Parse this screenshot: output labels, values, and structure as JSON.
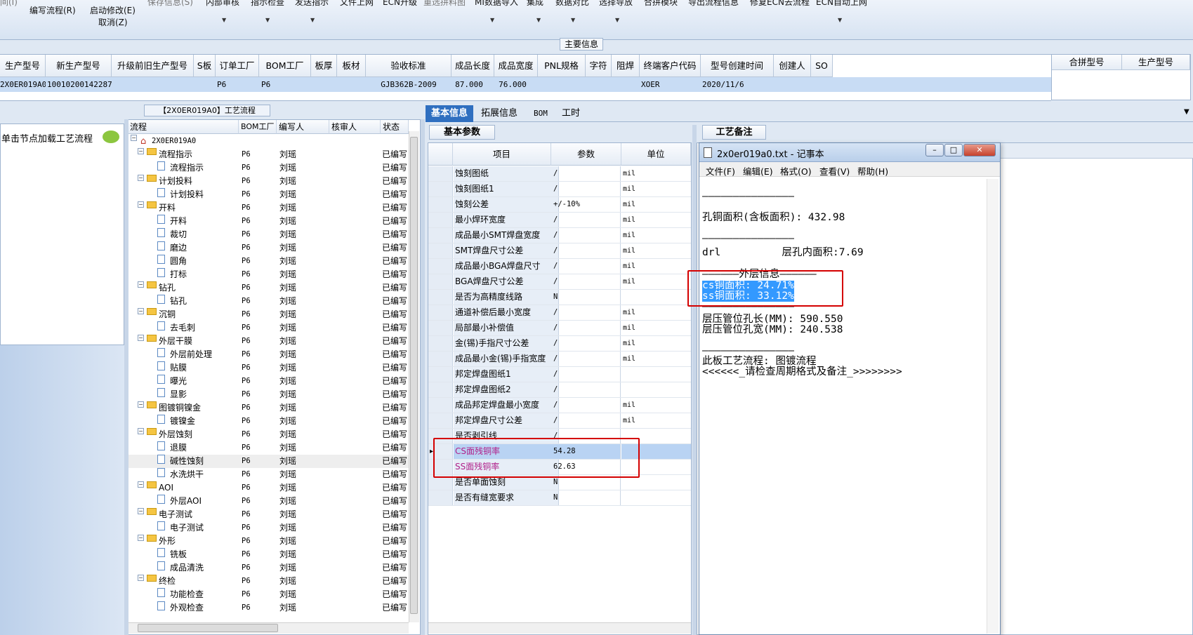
{
  "toolbar": {
    "row1": [
      "间(I)",
      "保存信息(S)",
      "内部审核",
      "指示检查",
      "发送指示",
      "文件上网",
      "ECN升级",
      "重选拼料图",
      "MI数据导入",
      "集成",
      "数据对比",
      "选择导放",
      "合拼模块",
      "导出流程信息",
      "修复ECN去流程",
      "ECN自动上网"
    ],
    "edit_flow": "编写流程(R)",
    "start_modify": "启动修改(E)",
    "cancel": "取消(Z)"
  },
  "main_info": {
    "title": "主要信息",
    "columns": [
      "生产型号",
      "新生产型号",
      "升级前旧生产型号",
      "S板",
      "订单工厂",
      "BOM工厂",
      "板厚",
      "板材",
      "验收标准",
      "成品长度",
      "成品宽度",
      "PNL规格",
      "字符",
      "阻焊",
      "终端客户代码",
      "型号创建时间",
      "创建人",
      "SO"
    ],
    "row": {
      "production_model": "2X0ER019A0",
      "new_model": "10010200142287",
      "order_factory": "P6",
      "bom_factory": "P6",
      "standard": "GJB362B-2009",
      "length": "87.000",
      "width": "76.000",
      "customer_code": "XOER",
      "created": "2020/11/6"
    },
    "merge_columns": [
      "合拼型号",
      "生产型号"
    ]
  },
  "left_panel": {
    "hint": "单击节点加载工艺流程"
  },
  "tree": {
    "title": "【2X0ER019A0】工艺流程",
    "columns": [
      "流程",
      "BOM工厂",
      "编写人",
      "核审人",
      "状态"
    ],
    "root": "2X0ER019A0",
    "rows": [
      {
        "name": "流程指示",
        "level": 1,
        "factory": "P6",
        "author": "刘瑶",
        "status": "已编写"
      },
      {
        "name": "流程指示",
        "level": 2,
        "factory": "P6",
        "author": "刘瑶",
        "status": "已编写"
      },
      {
        "name": "计划投料",
        "level": 1,
        "factory": "P6",
        "author": "刘瑶",
        "status": "已编写"
      },
      {
        "name": "计划投料",
        "level": 2,
        "factory": "P6",
        "author": "刘瑶",
        "status": "已编写"
      },
      {
        "name": "开料",
        "level": 1,
        "factory": "P6",
        "author": "刘瑶",
        "status": "已编写"
      },
      {
        "name": "开料",
        "level": 2,
        "factory": "P6",
        "author": "刘瑶",
        "status": "已编写"
      },
      {
        "name": "裁切",
        "level": 2,
        "factory": "P6",
        "author": "刘瑶",
        "status": "已编写"
      },
      {
        "name": "磨边",
        "level": 2,
        "factory": "P6",
        "author": "刘瑶",
        "status": "已编写"
      },
      {
        "name": "圆角",
        "level": 2,
        "factory": "P6",
        "author": "刘瑶",
        "status": "已编写"
      },
      {
        "name": "打标",
        "level": 2,
        "factory": "P6",
        "author": "刘瑶",
        "status": "已编写"
      },
      {
        "name": "钻孔",
        "level": 1,
        "factory": "P6",
        "author": "刘瑶",
        "status": "已编写"
      },
      {
        "name": "钻孔",
        "level": 2,
        "factory": "P6",
        "author": "刘瑶",
        "status": "已编写"
      },
      {
        "name": "沉铜",
        "level": 1,
        "factory": "P6",
        "author": "刘瑶",
        "status": "已编写"
      },
      {
        "name": "去毛刺",
        "level": 2,
        "factory": "P6",
        "author": "刘瑶",
        "status": "已编写"
      },
      {
        "name": "外层干膜",
        "level": 1,
        "factory": "P6",
        "author": "刘瑶",
        "status": "已编写"
      },
      {
        "name": "外层前处理",
        "level": 2,
        "factory": "P6",
        "author": "刘瑶",
        "status": "已编写"
      },
      {
        "name": "贴膜",
        "level": 2,
        "factory": "P6",
        "author": "刘瑶",
        "status": "已编写"
      },
      {
        "name": "曝光",
        "level": 2,
        "factory": "P6",
        "author": "刘瑶",
        "status": "已编写"
      },
      {
        "name": "显影",
        "level": 2,
        "factory": "P6",
        "author": "刘瑶",
        "status": "已编写"
      },
      {
        "name": "图镀铜镍金",
        "level": 1,
        "factory": "P6",
        "author": "刘瑶",
        "status": "已编写"
      },
      {
        "name": "镀镍金",
        "level": 2,
        "factory": "P6",
        "author": "刘瑶",
        "status": "已编写"
      },
      {
        "name": "外层蚀刻",
        "level": 1,
        "factory": "P6",
        "author": "刘瑶",
        "status": "已编写"
      },
      {
        "name": "退膜",
        "level": 2,
        "factory": "P6",
        "author": "刘瑶",
        "status": "已编写"
      },
      {
        "name": "碱性蚀刻",
        "level": 2,
        "factory": "P6",
        "author": "刘瑶",
        "status": "已编写",
        "selected": true
      },
      {
        "name": "水洗烘干",
        "level": 2,
        "factory": "P6",
        "author": "刘瑶",
        "status": "已编写"
      },
      {
        "name": "AOI",
        "level": 1,
        "factory": "P6",
        "author": "刘瑶",
        "status": "已编写"
      },
      {
        "name": "外层AOI",
        "level": 2,
        "factory": "P6",
        "author": "刘瑶",
        "status": "已编写"
      },
      {
        "name": "电子测试",
        "level": 1,
        "factory": "P6",
        "author": "刘瑶",
        "status": "已编写"
      },
      {
        "name": "电子测试",
        "level": 2,
        "factory": "P6",
        "author": "刘瑶",
        "status": "已编写"
      },
      {
        "name": "外形",
        "level": 1,
        "factory": "P6",
        "author": "刘瑶",
        "status": "已编写"
      },
      {
        "name": "铣板",
        "level": 2,
        "factory": "P6",
        "author": "刘瑶",
        "status": "已编写"
      },
      {
        "name": "成品清洗",
        "level": 2,
        "factory": "P6",
        "author": "刘瑶",
        "status": "已编写"
      },
      {
        "name": "终检",
        "level": 1,
        "factory": "P6",
        "author": "刘瑶",
        "status": "已编写"
      },
      {
        "name": "功能检查",
        "level": 2,
        "factory": "P6",
        "author": "刘瑶",
        "status": "已编写"
      },
      {
        "name": "外观检查",
        "level": 2,
        "factory": "P6",
        "author": "刘瑶",
        "status": "已编写"
      }
    ]
  },
  "tabs": [
    "基本信息",
    "拓展信息",
    "BOM",
    "工时"
  ],
  "params": {
    "tab": "基本参数",
    "columns": [
      "项目",
      "参数",
      "单位"
    ],
    "rows": [
      {
        "item": "蚀刻图纸",
        "value": "/",
        "unit": "mil"
      },
      {
        "item": "蚀刻图纸1",
        "value": "/",
        "unit": "mil"
      },
      {
        "item": "蚀刻公差",
        "value": "+/-10%",
        "unit": "mil"
      },
      {
        "item": "最小焊环宽度",
        "value": "/",
        "unit": "mil"
      },
      {
        "item": "成品最小SMT焊盘宽度",
        "value": "/",
        "unit": "mil"
      },
      {
        "item": "SMT焊盘尺寸公差",
        "value": "/",
        "unit": "mil"
      },
      {
        "item": "成品最小BGA焊盘尺寸",
        "value": "/",
        "unit": "mil"
      },
      {
        "item": "BGA焊盘尺寸公差",
        "value": "/",
        "unit": "mil"
      },
      {
        "item": "是否为高精度线路",
        "value": "N",
        "unit": ""
      },
      {
        "item": "通道补偿后最小宽度",
        "value": "/",
        "unit": "mil"
      },
      {
        "item": "局部最小补偿值",
        "value": "/",
        "unit": "mil"
      },
      {
        "item": "金(锡)手指尺寸公差",
        "value": "/",
        "unit": "mil"
      },
      {
        "item": "成品最小金(锡)手指宽度",
        "value": "/",
        "unit": "mil"
      },
      {
        "item": "邦定焊盘图纸1",
        "value": "/",
        "unit": ""
      },
      {
        "item": "邦定焊盘图纸2",
        "value": "/",
        "unit": ""
      },
      {
        "item": "成品邦定焊盘最小宽度",
        "value": "/",
        "unit": "mil"
      },
      {
        "item": "邦定焊盘尺寸公差",
        "value": "/",
        "unit": "mil"
      },
      {
        "item": "是否剥引线",
        "value": "/",
        "unit": ""
      },
      {
        "item": "CS面残铜率",
        "value": "54.28",
        "unit": "",
        "selected": true,
        "highlight": true
      },
      {
        "item": "SS面残铜率",
        "value": "62.63",
        "unit": "",
        "highlight": true
      },
      {
        "item": "是否单面蚀刻",
        "value": "N",
        "unit": ""
      },
      {
        "item": "是否有缝宽要求",
        "value": "N",
        "unit": ""
      }
    ]
  },
  "remark": {
    "tab": "工艺备注"
  },
  "notepad": {
    "title": "2x0er019a0.txt - 记事本",
    "menus": [
      "文件(F)",
      "编辑(E)",
      "格式(O)",
      "查看(V)",
      "帮助(H)"
    ],
    "lines": [
      "———————————————",
      "",
      "孔铜面积(含板面积): 432.98",
      "",
      "———————————————",
      "drl          层孔内面积:7.69",
      "",
      "——————外层信息——————",
      "cs铜面积: 24.71%",
      "ss铜面积: 33.12%",
      "———————————————",
      "层压管位孔长(MM): 590.550",
      "层压管位孔宽(MM): 240.538",
      "",
      "———————————————",
      "此板工艺流程: 图镀流程",
      "<<<<<<_请检查周期格式及备注_>>>>>>>>"
    ]
  }
}
